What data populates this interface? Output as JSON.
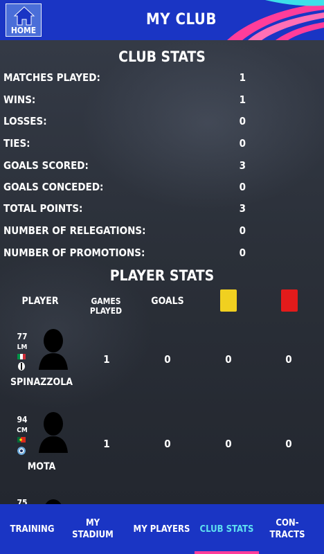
{
  "header": {
    "home_label": "HOME",
    "title": "MY CLUB"
  },
  "club_stats": {
    "title": "CLUB STATS",
    "rows": [
      {
        "label": "MATCHES PLAYED:",
        "value": "1"
      },
      {
        "label": "WINS:",
        "value": "1"
      },
      {
        "label": "LOSSES:",
        "value": "0"
      },
      {
        "label": "TIES:",
        "value": "0"
      },
      {
        "label": "GOALS SCORED:",
        "value": "3"
      },
      {
        "label": "GOALS CONCEDED:",
        "value": "0"
      },
      {
        "label": "TOTAL POINTS:",
        "value": "3"
      },
      {
        "label": "NUMBER OF RELEGATIONS:",
        "value": "0"
      },
      {
        "label": "NUMBER OF PROMOTIONS:",
        "value": "0"
      }
    ]
  },
  "player_stats": {
    "title": "PLAYER STATS",
    "headers": {
      "player": "PLAYER",
      "games_played": "GAMES PLAYED",
      "goals": "GOALS",
      "yellow_card_icon": "yellow-card",
      "red_card_icon": "red-card"
    },
    "players": [
      {
        "rating": "77",
        "position": "LM",
        "name": "SPINAZZOLA",
        "games": "1",
        "goals": "0",
        "yellow": "0",
        "red": "0",
        "flag": "italy-flag",
        "club": "juventus-crest"
      },
      {
        "rating": "94",
        "position": "CM",
        "name": "MOTA",
        "games": "1",
        "goals": "0",
        "yellow": "0",
        "red": "0",
        "flag": "portugal-flag",
        "club": "man-city-crest"
      },
      {
        "rating": "75",
        "position": "",
        "name": "",
        "games": "",
        "goals": "",
        "yellow": "",
        "red": "",
        "flag": "",
        "club": ""
      }
    ]
  },
  "nav": {
    "items": [
      {
        "label": "TRAINING"
      },
      {
        "label": "MY STADIUM"
      },
      {
        "label": "MY PLAYERS"
      },
      {
        "label": "CLUB STATS"
      },
      {
        "label": "CON-TRACTS"
      }
    ],
    "active_color": "#5ee0f0",
    "underline_color": "#ff3d9a"
  },
  "colors": {
    "brand_blue": "#1a35c4",
    "yellow_card": "#f0d020",
    "red_card": "#e31b1b"
  }
}
